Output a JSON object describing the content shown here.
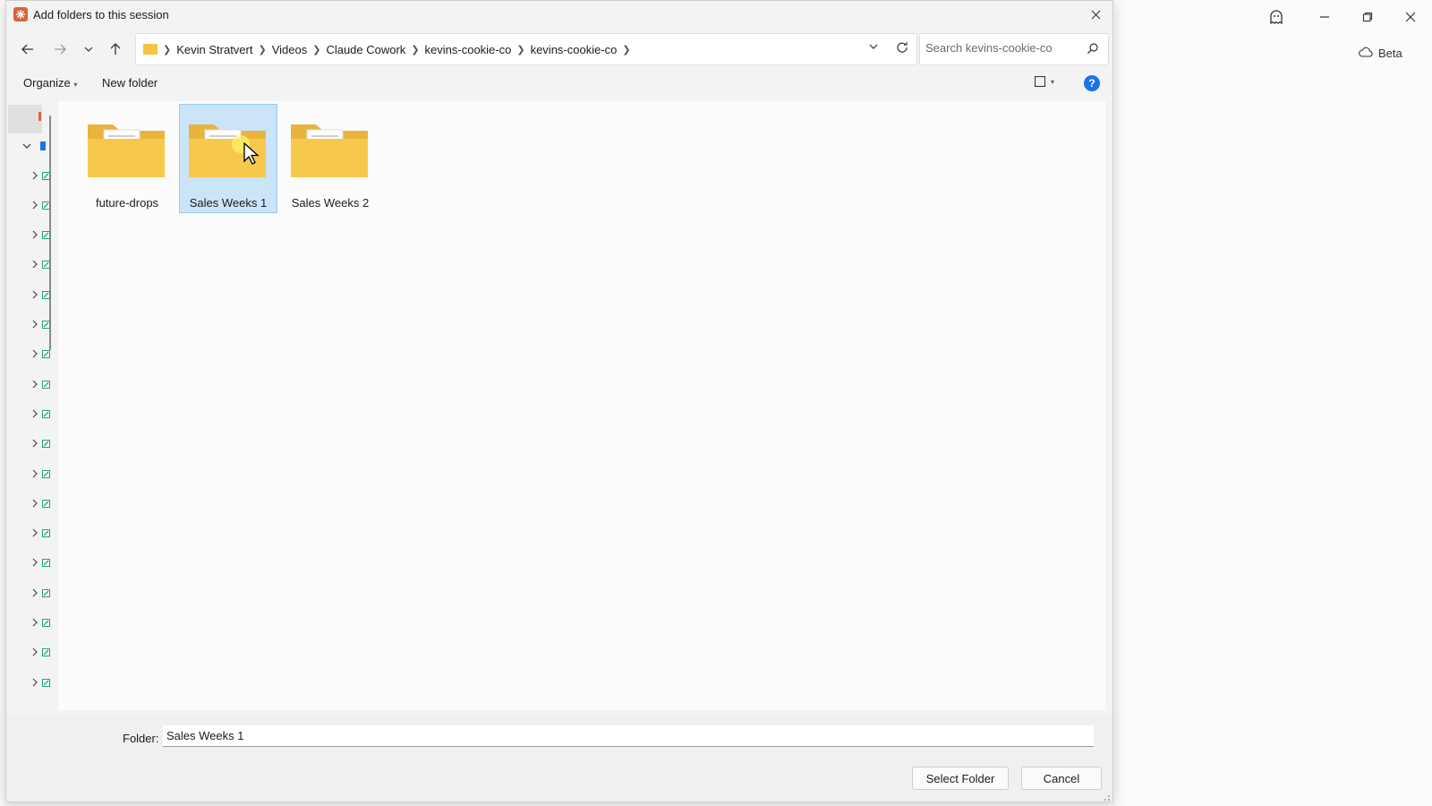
{
  "dialog": {
    "title": "Add folders to this session",
    "breadcrumb": [
      "Kevin Stratvert",
      "Videos",
      "Claude Cowork",
      "kevins-cookie-co",
      "kevins-cookie-co"
    ],
    "search_placeholder": "Search kevins-cookie-co",
    "toolbar": {
      "organize_label": "Organize",
      "new_folder_label": "New folder"
    },
    "help_glyph": "?",
    "folders": [
      {
        "name": "future-drops",
        "selected": false
      },
      {
        "name": "Sales Weeks 1",
        "selected": true
      },
      {
        "name": "Sales Weeks 2",
        "selected": false
      }
    ],
    "folder_label": "Folder:",
    "folder_value": "Sales Weeks 1",
    "select_button": "Select Folder",
    "cancel_button": "Cancel"
  },
  "background_app": {
    "beta_label": "Beta"
  },
  "colors": {
    "selection_bg": "#cce4f7",
    "selection_border": "#99c9ef",
    "folder_yellow": "#f4c542",
    "help_blue": "#1a73e8",
    "app_icon": "#d9623d"
  }
}
